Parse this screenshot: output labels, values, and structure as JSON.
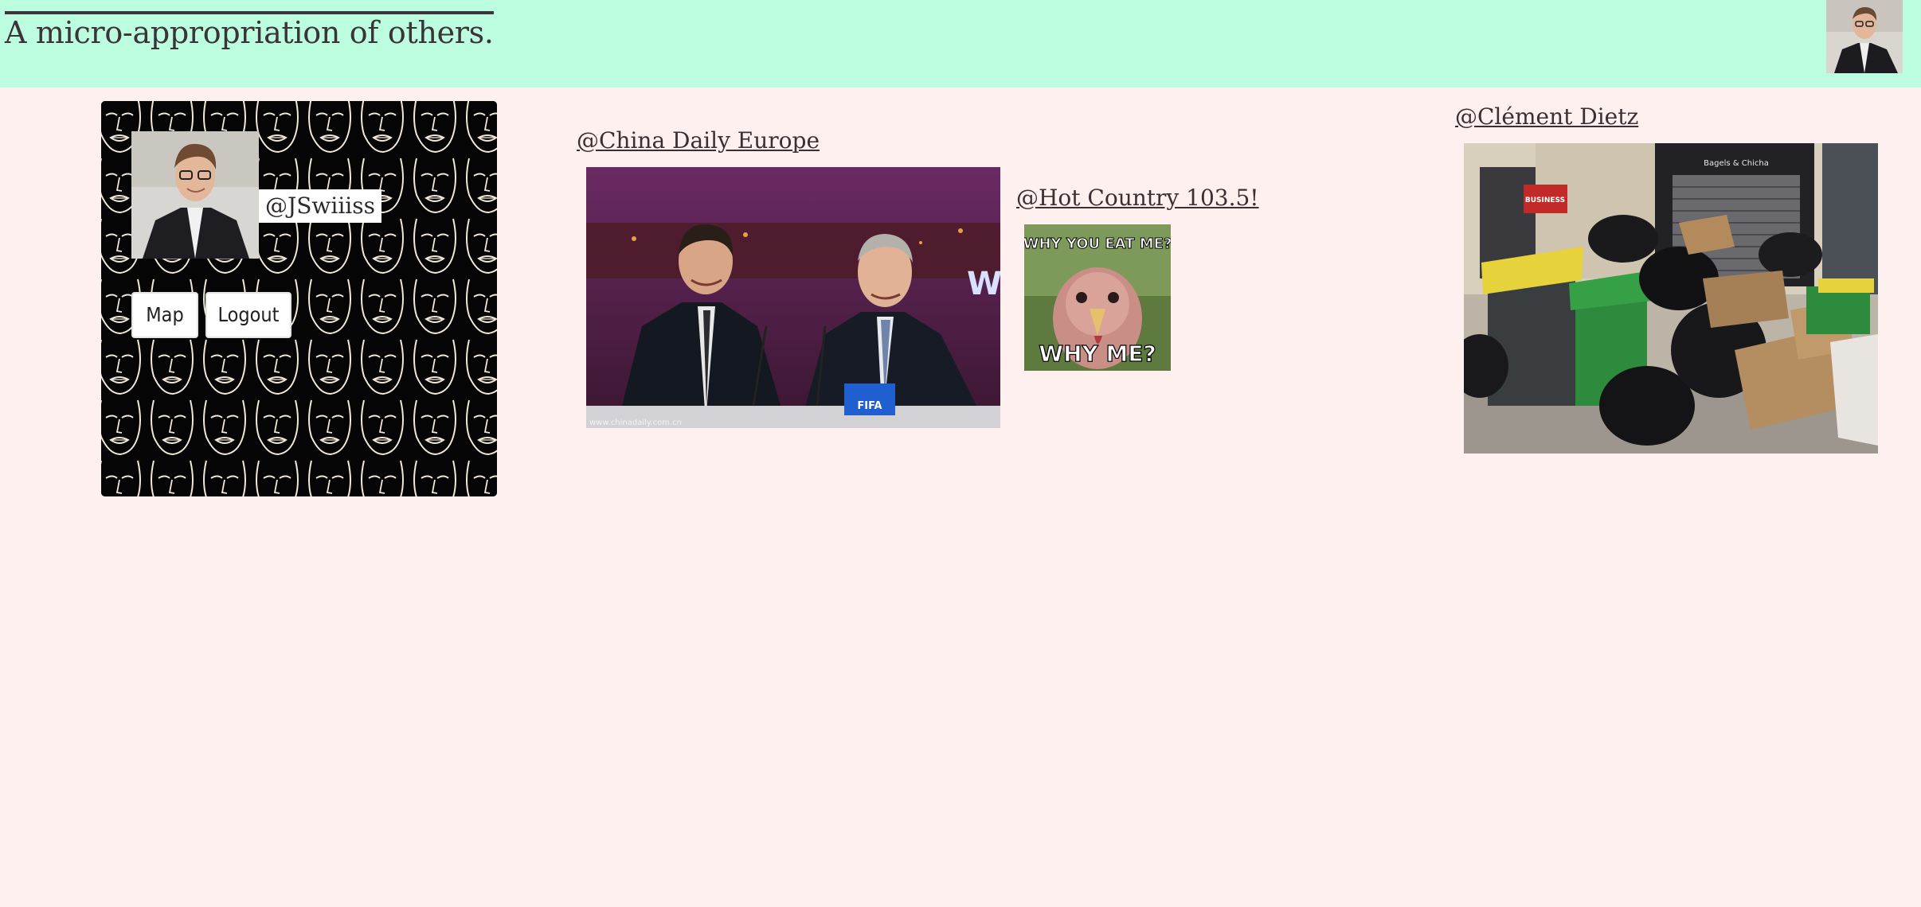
{
  "header": {
    "title": "A micro-appropriation of others."
  },
  "profile": {
    "handle": "@JSwiiiss",
    "buttons": {
      "map": "Map",
      "logout": "Logout"
    }
  },
  "posts": [
    {
      "author": "@China Daily Europe",
      "image_caption": "www.chinadaily.com.cn",
      "badge": "FIFA"
    },
    {
      "author": "@Hot Country 103.5!",
      "meme_top": "WHY YOU EAT ME?",
      "meme_bottom": "WHY ME?"
    },
    {
      "author": "@Clément Dietz",
      "shop_sign": "Bagels & Chicha",
      "shop_sign_small": "BUSINESS"
    }
  ],
  "colors": {
    "header_bg": "#bcfcdf",
    "page_bg": "#fff0f0",
    "text": "#3a2f33"
  }
}
